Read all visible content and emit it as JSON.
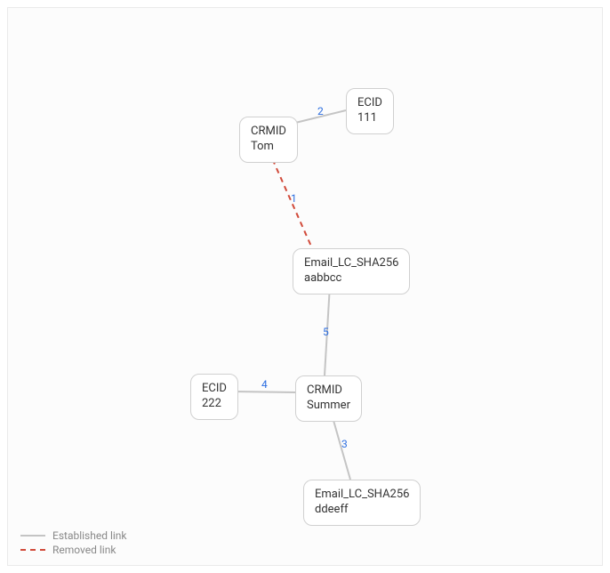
{
  "nodes": {
    "n1": {
      "type": "CRMID",
      "value": "Tom"
    },
    "n2": {
      "type": "ECID",
      "value": "111"
    },
    "n3": {
      "type": "Email_LC_SHA256",
      "value": "aabbcc"
    },
    "n4": {
      "type": "CRMID",
      "value": "Summer"
    },
    "n5": {
      "type": "ECID",
      "value": "222"
    },
    "n6": {
      "type": "Email_LC_SHA256",
      "value": "ddeeff"
    }
  },
  "edges": {
    "e1": {
      "label": "1"
    },
    "e2": {
      "label": "2"
    },
    "e3": {
      "label": "3"
    },
    "e4": {
      "label": "4"
    },
    "e5": {
      "label": "5"
    }
  },
  "legend": {
    "established": "Established link",
    "removed": "Removed link"
  }
}
